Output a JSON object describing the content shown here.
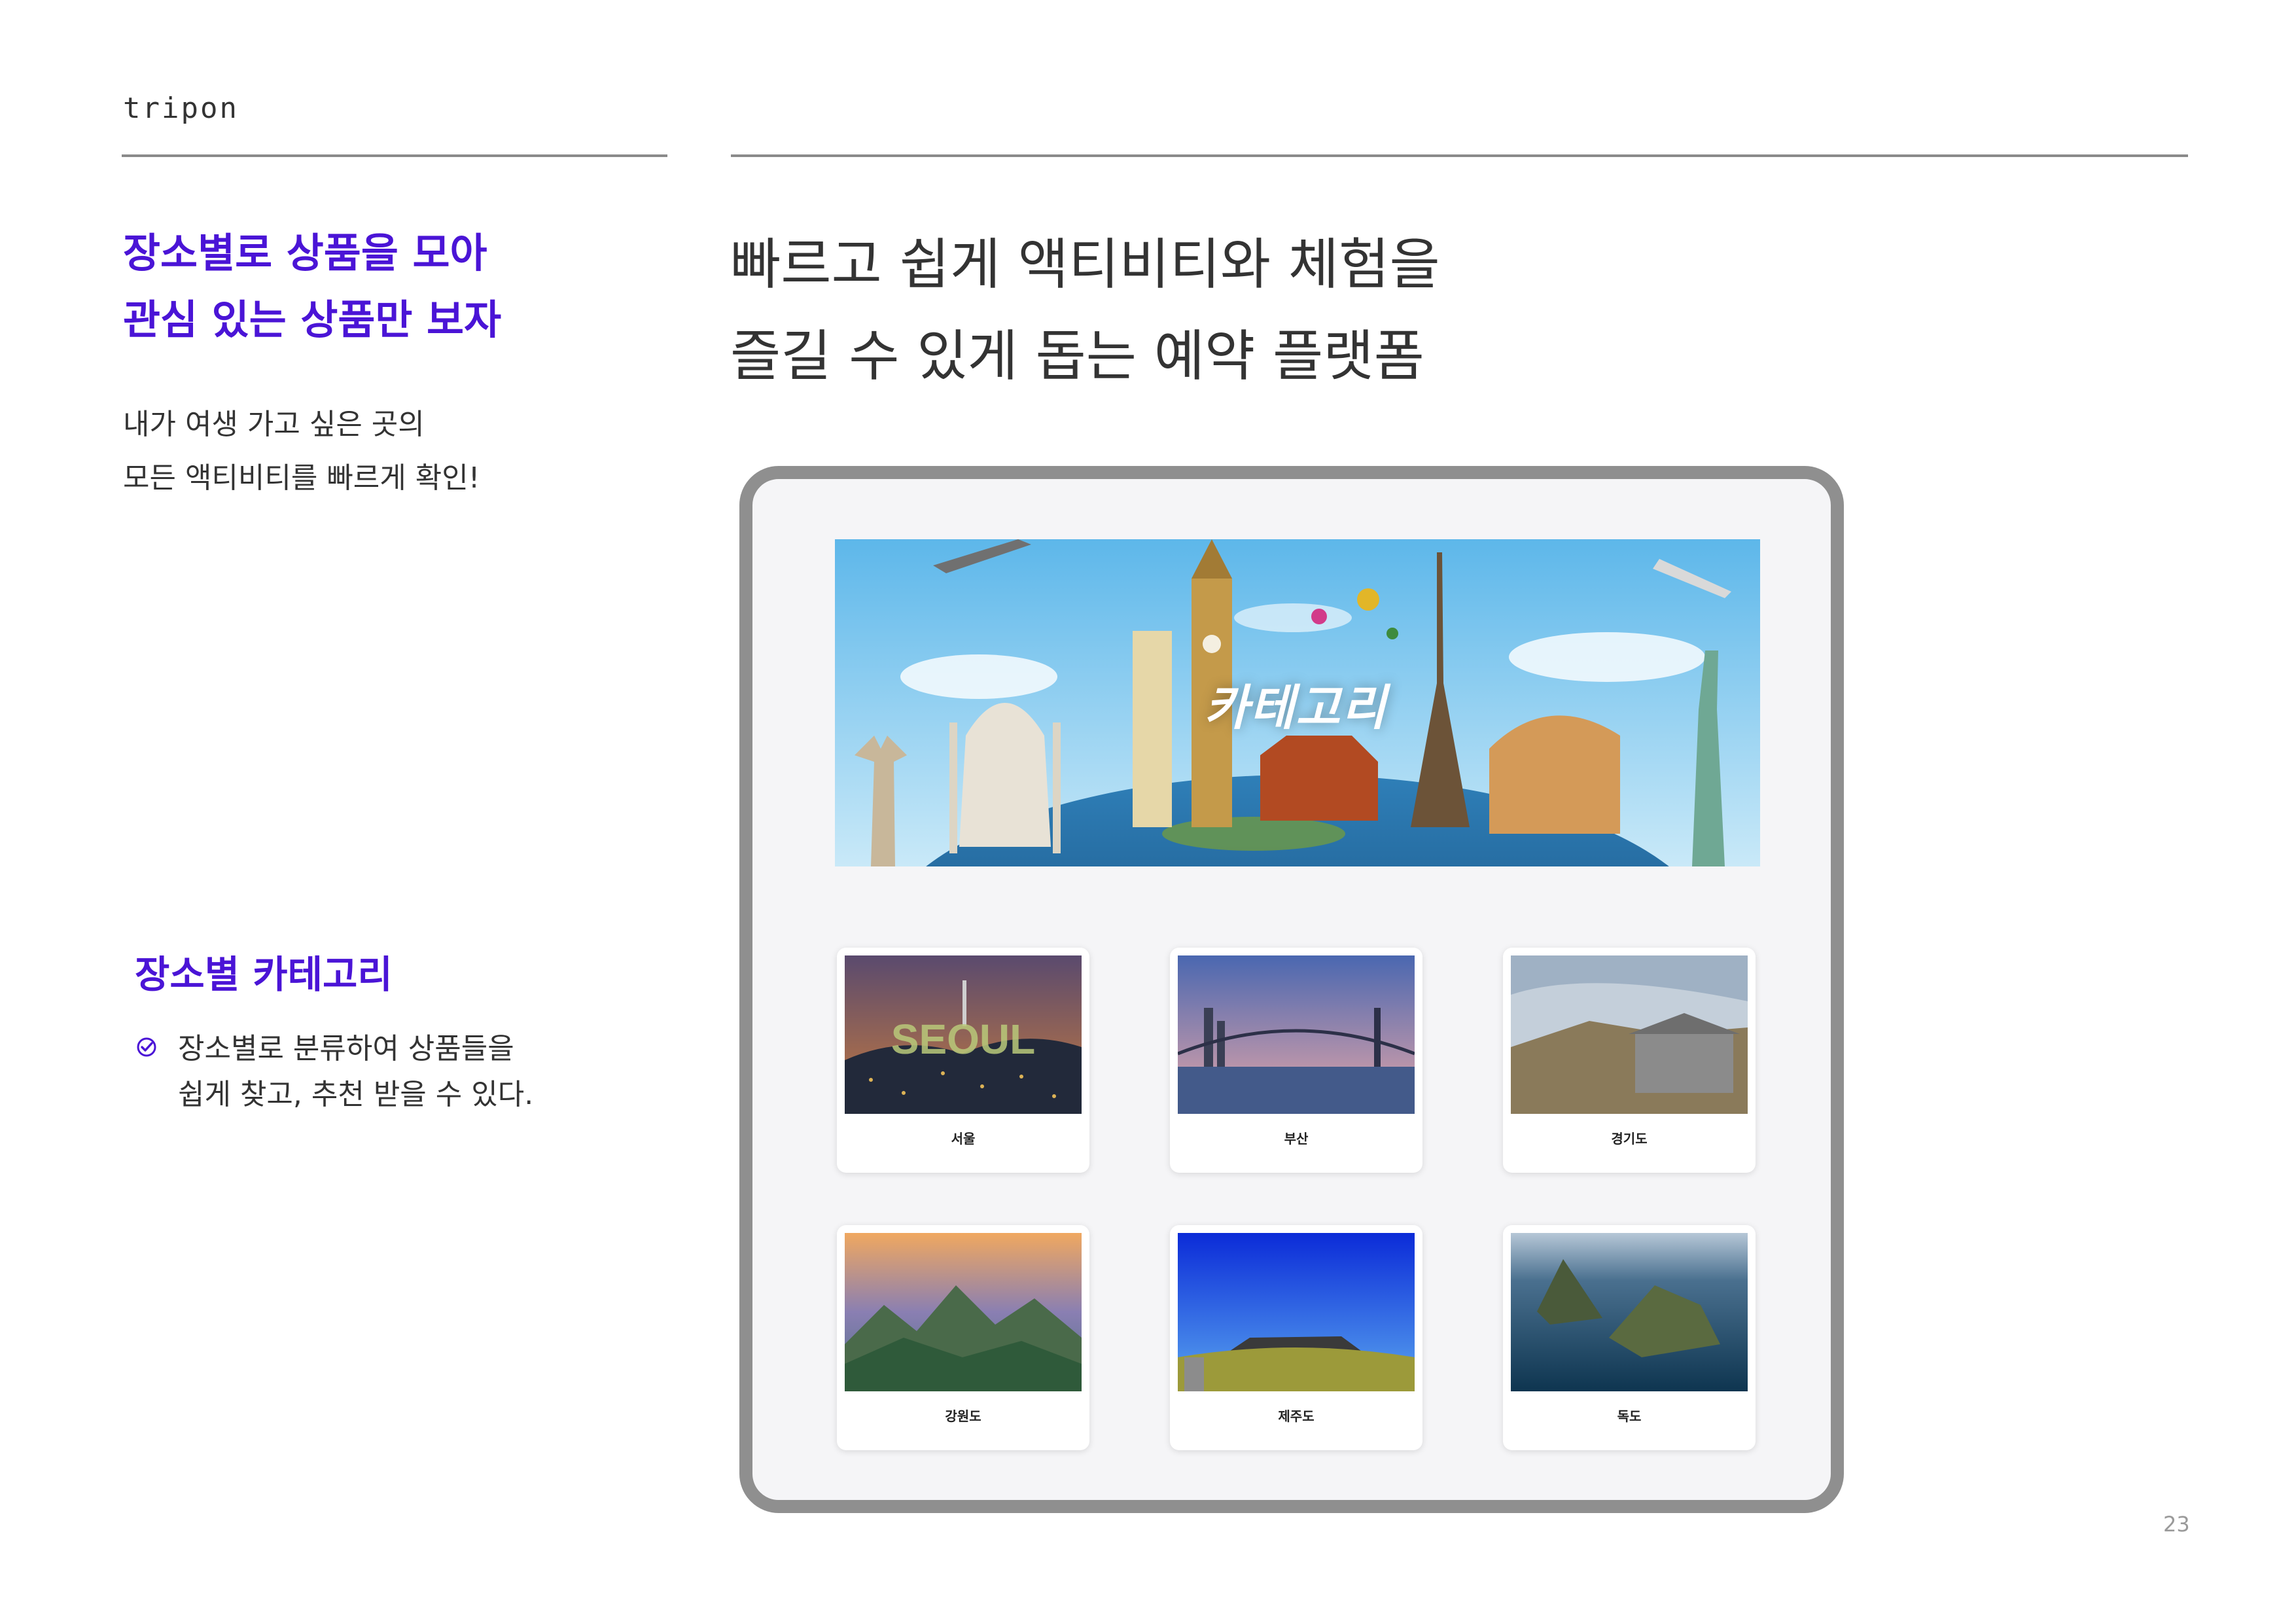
{
  "brand": "tripon",
  "lead": {
    "title_line1": "장소별로 상품을 모아",
    "title_line2": "관심 있는 상품만 보자",
    "sub_line1": "내가 여생 가고 싶은 곳의",
    "sub_line2": "모든 액티비티를 빠르게 확인!"
  },
  "headline": {
    "line1": "빠르고 쉽게 액티비티와 체험을",
    "line2": "즐길 수 있게 돕는 예약 플랫폼"
  },
  "category_section": {
    "title": "장소별 카테고리",
    "desc_line1": "장소별로 분류하여 상품들을",
    "desc_line2": "쉽게 찾고, 추천 받을 수 있다.",
    "check_icon": "check-circle-icon",
    "accent_color": "#4a14d6"
  },
  "app": {
    "banner_title": "카테고리",
    "seoul_sign": "SEOUL",
    "cards": [
      {
        "label": "서울"
      },
      {
        "label": "부산"
      },
      {
        "label": "경기도"
      },
      {
        "label": "강원도"
      },
      {
        "label": "제주도"
      },
      {
        "label": "독도"
      }
    ]
  },
  "page_number": "23"
}
